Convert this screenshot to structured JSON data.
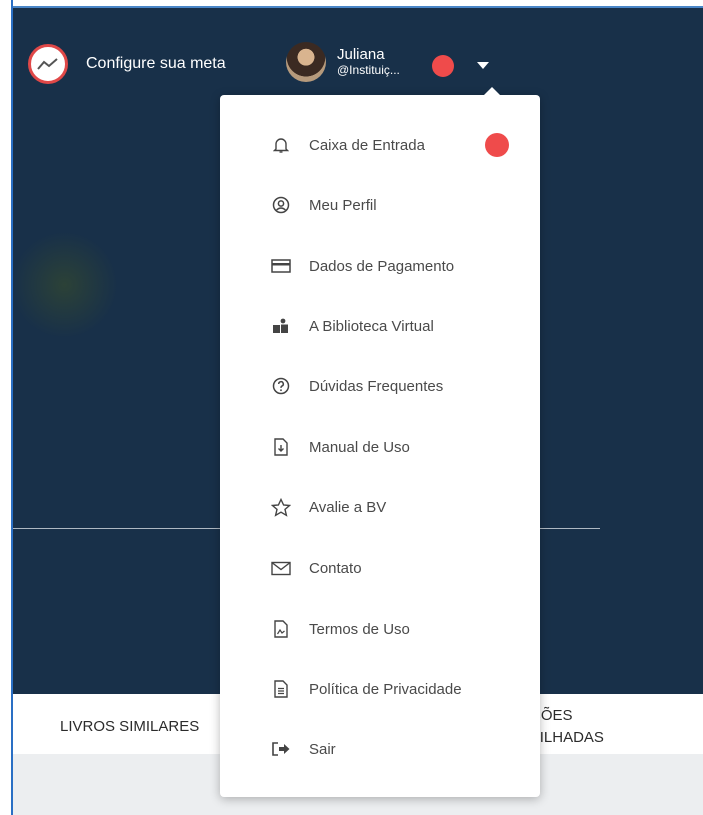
{
  "header": {
    "goal_label": "Configure sua meta",
    "user_name": "Juliana",
    "user_handle": "@Instituiç..."
  },
  "menu": {
    "items": [
      {
        "label": "Caixa de Entrada",
        "icon": "bell-icon"
      },
      {
        "label": "Meu Perfil",
        "icon": "user-circle-icon"
      },
      {
        "label": "Dados de Pagamento",
        "icon": "credit-card-icon"
      },
      {
        "label": "A Biblioteca Virtual",
        "icon": "people-icon"
      },
      {
        "label": "Dúvidas Frequentes",
        "icon": "question-circle-icon"
      },
      {
        "label": "Manual de Uso",
        "icon": "file-download-icon"
      },
      {
        "label": "Avalie a BV",
        "icon": "star-icon"
      },
      {
        "label": "Contato",
        "icon": "envelope-icon"
      },
      {
        "label": "Termos de Uso",
        "icon": "file-signature-icon"
      },
      {
        "label": "Política de Privacidade",
        "icon": "file-text-icon"
      },
      {
        "label": "Sair",
        "icon": "sign-out-icon"
      }
    ]
  },
  "tabs": {
    "similar": "LIVROS SIMILARES",
    "shared": "AÇÕES\nRTILHADAS"
  },
  "colors": {
    "background": "#183049",
    "badge": "#ef4b4b",
    "accent": "#2a6fc4"
  }
}
